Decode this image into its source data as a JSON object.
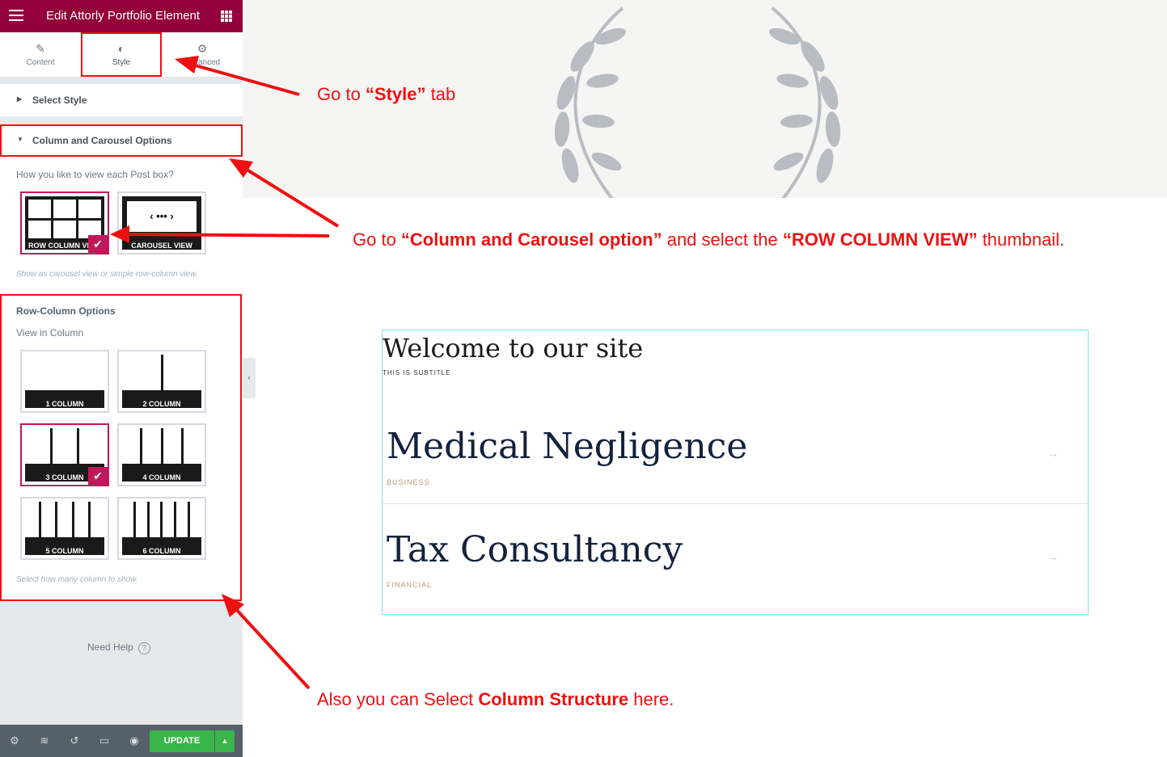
{
  "editor": {
    "title": "Edit Attorly Portfolio Element",
    "tabs": [
      {
        "label": "Content",
        "icon": "pencil-icon"
      },
      {
        "label": "Style",
        "icon": "half-circle-icon"
      },
      {
        "label": "Advanced",
        "icon": "gear-icon"
      }
    ],
    "sections": {
      "select_style": "Select Style",
      "column_carousel": "Column and Carousel Options"
    },
    "view_question": "How you like to view each Post box?",
    "view_options": [
      {
        "label": "ROW COLUMN VIEW",
        "selected": true
      },
      {
        "label": "CAROUSEL VIEW",
        "selected": false
      }
    ],
    "view_hint": "Show as carousel view or simple row-column view.",
    "row_column_title": "Row-Column Options",
    "view_in_column": "View in Column",
    "column_options": [
      {
        "label": "1 COLUMN",
        "cols": 1,
        "selected": false
      },
      {
        "label": "2 COLUMN",
        "cols": 2,
        "selected": false
      },
      {
        "label": "3 COLUMN",
        "cols": 3,
        "selected": true
      },
      {
        "label": "4 COLUMN",
        "cols": 4,
        "selected": false
      },
      {
        "label": "5 COLUMN",
        "cols": 5,
        "selected": false
      },
      {
        "label": "6 COLUMN",
        "cols": 6,
        "selected": false
      }
    ],
    "column_hint": "Select how many column to show.",
    "need_help": "Need Help",
    "update_label": "UPDATE",
    "accent": "#93003c",
    "update_color": "#39b54a"
  },
  "preview": {
    "heading": "Welcome to our site",
    "subtitle": "THIS IS SUBTITLE",
    "items": [
      {
        "title": "Medical Negligence",
        "category": "BUSINESS"
      },
      {
        "title": "Tax Consultancy",
        "category": "FINANCIAL"
      }
    ]
  },
  "annotations": {
    "style_tab": {
      "pre": "Go  to ",
      "bold": "“Style”",
      "post": " tab"
    },
    "carousel": {
      "pre": "Go to ",
      "bold1": "“Column and Carousel option”",
      "mid": " and select the ",
      "bold2": "“ROW COLUMN VIEW”",
      "post": " thumbnail."
    },
    "structure": {
      "pre": "Also you can Select ",
      "bold": "Column Structure",
      "post": " here."
    },
    "color": "#ee1111"
  }
}
